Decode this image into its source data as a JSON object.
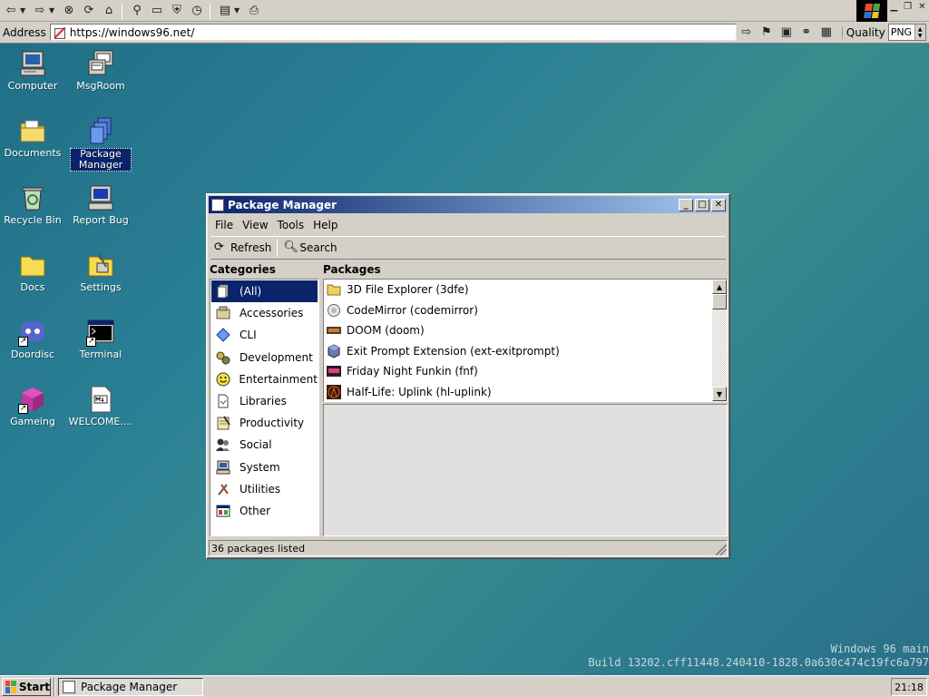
{
  "browser": {
    "address_label": "Address",
    "url": "https://windows96.net/",
    "quality_label": "Quality",
    "quality_value": "PNG"
  },
  "desktop": {
    "icons": [
      {
        "label": "Computer"
      },
      {
        "label": "MsgRoom"
      },
      {
        "label": "Documents"
      },
      {
        "label": "Package Manager"
      },
      {
        "label": "Recycle Bin"
      },
      {
        "label": "Report Bug"
      },
      {
        "label": "Docs"
      },
      {
        "label": "Settings"
      },
      {
        "label": "Doordisc"
      },
      {
        "label": "Terminal"
      },
      {
        "label": "Gameing"
      },
      {
        "label": "WELCOME...."
      }
    ]
  },
  "window": {
    "title": "Package Manager",
    "menu": [
      "File",
      "View",
      "Tools",
      "Help"
    ],
    "toolbar": {
      "refresh": "Refresh",
      "search": "Search"
    },
    "categories_heading": "Categories",
    "packages_heading": "Packages",
    "categories": [
      "(All)",
      "Accessories",
      "CLI",
      "Development",
      "Entertainment",
      "Libraries",
      "Productivity",
      "Social",
      "System",
      "Utilities",
      "Other"
    ],
    "packages": [
      "3D File Explorer (3dfe)",
      "CodeMirror (codemirror)",
      "DOOM (doom)",
      "Exit Prompt Extension (ext-exitprompt)",
      "Friday Night Funkin (fnf)",
      "Half-Life: Uplink (hl-uplink)"
    ],
    "status": "36 packages listed"
  },
  "build_info": {
    "line1": "Windows 96 main",
    "line2": "Build 13202.cff11448.240410-1828.0a630c474c19fc6a797"
  },
  "taskbar": {
    "start_label": "Start",
    "task_label": "Package Manager",
    "clock": "21:18"
  }
}
